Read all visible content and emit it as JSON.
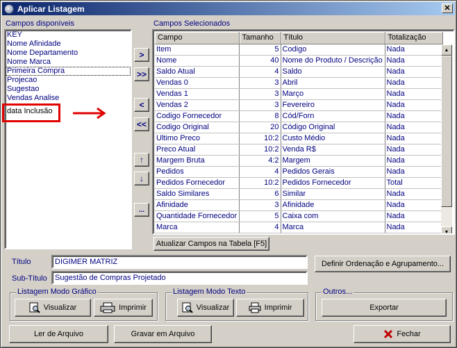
{
  "window": {
    "title": "Aplicar Listagem"
  },
  "left_panel": {
    "label": "Campos disponíveis",
    "items": [
      "KEY",
      "Nome Afinidade",
      "Nome Departamento",
      "Nome Marca",
      "Primeira Compra",
      "Projecao",
      "Sugestao",
      "Vendas Analise",
      "data Inclusão"
    ]
  },
  "move_buttons": {
    "add_one": ">",
    "add_all": ">>",
    "remove_one": "<",
    "remove_all": "<<",
    "up": "↑",
    "down": "↓",
    "more": "..."
  },
  "right_panel": {
    "label": "Campos Selecionados",
    "columns": [
      "Campo",
      "Tamanho",
      "Título",
      "Totalização"
    ],
    "rows": [
      [
        "Item",
        "5",
        "Codigo",
        "Nada"
      ],
      [
        "Nome",
        "40",
        "Nome do Produto / Descrição",
        "Nada"
      ],
      [
        "Saldo Atual",
        "4",
        "Saldo",
        "Nada"
      ],
      [
        "Vendas 0",
        "3",
        "Abril",
        "Nada"
      ],
      [
        "Vendas 1",
        "3",
        "Março",
        "Nada"
      ],
      [
        "Vendas 2",
        "3",
        "Fevereiro",
        "Nada"
      ],
      [
        "Codigo Fornecedor",
        "8",
        "Cód/Forn",
        "Nada"
      ],
      [
        "Codigo Original",
        "20",
        "Código Original",
        "Nada"
      ],
      [
        "Ultimo Preco",
        "10:2",
        "Custo Médio",
        "Nada"
      ],
      [
        "Preco Atual",
        "10:2",
        "Venda R$",
        "Nada"
      ],
      [
        "Margem Bruta",
        "4:2",
        "Margem",
        "Nada"
      ],
      [
        "Pedidos",
        "4",
        "Pedidos Gerais",
        "Nada"
      ],
      [
        "Pedidos Fornecedor",
        "10:2",
        "Pedidos Fornecedor",
        "Total"
      ],
      [
        "Saldo Similares",
        "6",
        "Similar",
        "Nada"
      ],
      [
        "Afinidade",
        "3",
        "Afinidade",
        "Nada"
      ],
      [
        "Quantidade Fornecedor",
        "5",
        "Caixa com",
        "Nada"
      ],
      [
        "Marca",
        "4",
        "Marca",
        "Nada"
      ]
    ],
    "update_button": "Atualizar Campos na Tabela [F5]"
  },
  "form": {
    "titulo_label": "Título",
    "titulo_value": "DIGIMER MATRIZ",
    "subtitulo_label": "Sub-Título",
    "subtitulo_value": "Sugestão de Compras Projetado",
    "ordering_button": "Definir Ordenação e Agrupamento..."
  },
  "group_grafico": {
    "title": "Listagem Modo Gráfico",
    "visualizar": "Visualizar",
    "imprimir": "Imprimir"
  },
  "group_texto": {
    "title": "Listagem Modo Texto",
    "visualizar": "Visualizar",
    "imprimir": "Imprimir"
  },
  "group_outros": {
    "title": "Outros...",
    "exportar": "Exportar"
  },
  "bottom": {
    "ler": "Ler de Arquivo",
    "gravar": "Gravar em Arquivo",
    "fechar": "Fechar"
  },
  "colors": {
    "annotation_red": "#e00000",
    "titlebar": "#0a246a",
    "text_blue": "#000080"
  }
}
